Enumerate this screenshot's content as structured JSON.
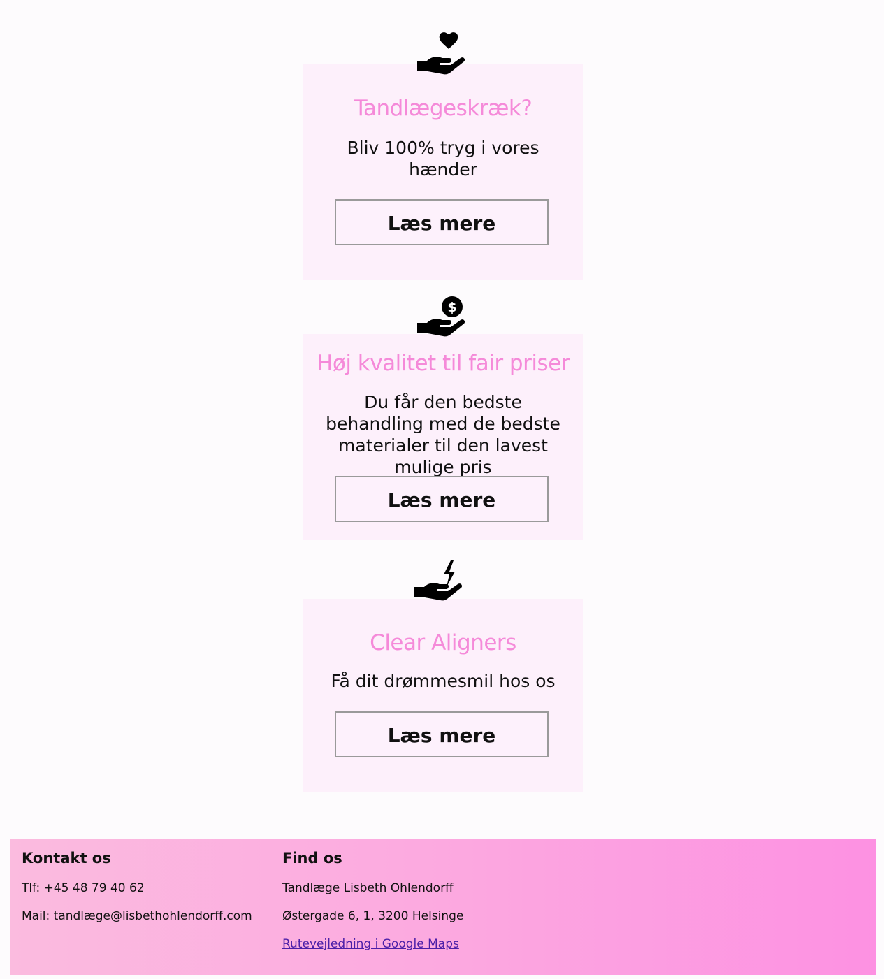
{
  "cards": [
    {
      "icon": "hand-heart-icon",
      "title": "Tandlægeskræk?",
      "text": "Bliv 100% tryg i vores hænder",
      "button": "Læs mere"
    },
    {
      "icon": "hand-dollar-icon",
      "title": "Høj kvalitet til fair priser",
      "text": "Du får den bedste behandling med de bedste materialer til den lavest mulige pris",
      "button": "Læs mere"
    },
    {
      "icon": "hand-lightning-icon",
      "title": "Clear Aligners",
      "text": "Få dit drømmesmil hos os",
      "button": "Læs mere"
    }
  ],
  "footer": {
    "contact": {
      "heading": "Kontakt os",
      "phone": "Tlf: +45 48 79 40 62",
      "mail": "Mail: tandlæge@lisbethohlendorff.com"
    },
    "find": {
      "heading": "Find os",
      "name": "Tandlæge Lisbeth Ohlendorff",
      "address": "Østergade 6, 1, 3200 Helsinge",
      "link": "Rutevejledning i Google Maps"
    }
  },
  "colors": {
    "accent": "#f58ad9",
    "card_bg": "#fdf0fb",
    "link": "#4b1fa8"
  }
}
